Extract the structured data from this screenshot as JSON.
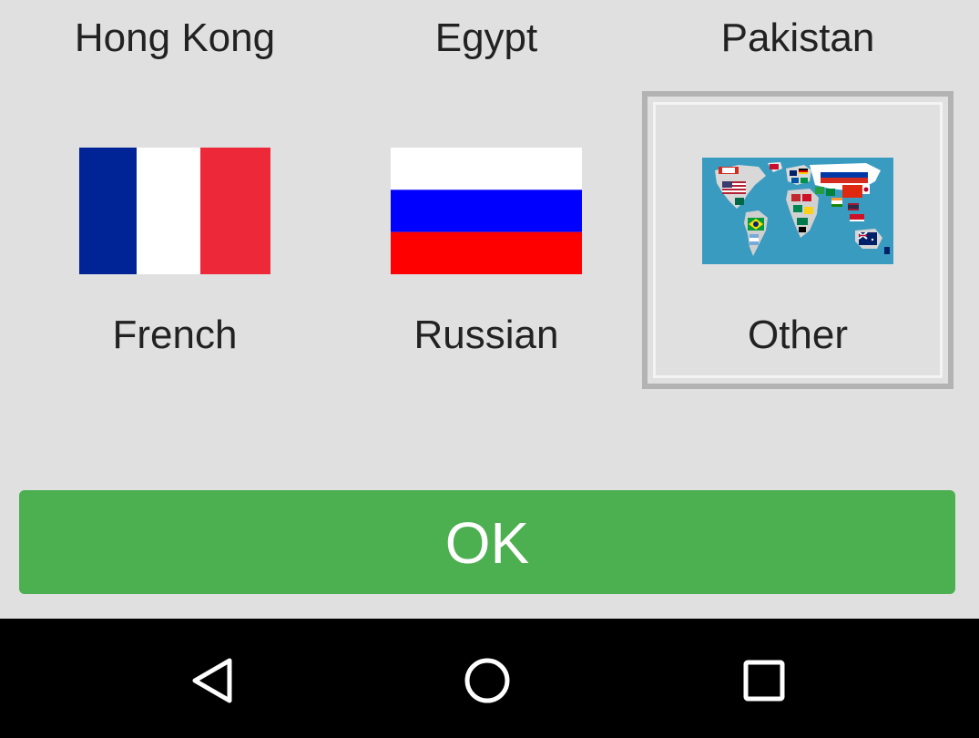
{
  "top_row": {
    "labels": [
      "Hong Kong",
      "Egypt",
      "Pakistan"
    ]
  },
  "languages": [
    {
      "label": "French",
      "flag_icon": "france-flag-icon",
      "selected": false
    },
    {
      "label": "Russian",
      "flag_icon": "russia-flag-icon",
      "selected": false
    },
    {
      "label": "Other",
      "flag_icon": "world-flags-map-icon",
      "selected": true
    }
  ],
  "ok_button": {
    "label": "OK"
  },
  "colors": {
    "background": "#e0e0e0",
    "ok_green": "#4caf50",
    "selection_border": "#b3b3b3",
    "navbar": "#000000",
    "france_blue": "#002395",
    "france_red": "#ed2939",
    "russia_blue": "#0000ff",
    "russia_red": "#ff0000"
  },
  "navbar": {
    "icons": [
      "back-icon",
      "home-icon",
      "recents-icon"
    ]
  }
}
